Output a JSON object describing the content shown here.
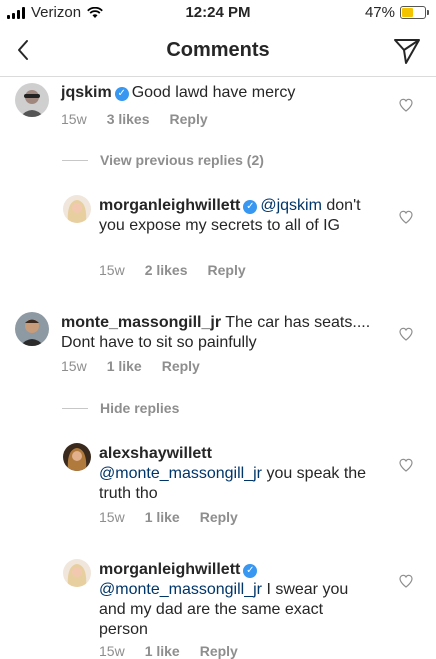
{
  "status_bar": {
    "carrier": "Verizon",
    "time": "12:24 PM",
    "battery_pct": "47%",
    "battery_level": 0.47
  },
  "nav": {
    "title": "Comments"
  },
  "comments": [
    {
      "username": "jqskim",
      "verified": true,
      "text": "Good lawd have mercy",
      "age": "15w",
      "likes": "3 likes",
      "reply": "Reply"
    },
    {
      "username": "morganleighwillett",
      "verified": true,
      "mention": "@jqskim",
      "text": "don't you expose my secrets to all of IG",
      "age": "15w",
      "likes": "2 likes",
      "reply": "Reply"
    },
    {
      "username": "monte_massongill_jr",
      "verified": false,
      "text": "The car has seats.... Dont have to sit so painfully",
      "age": "15w",
      "likes": "1 like",
      "reply": "Reply"
    },
    {
      "username": "alexshaywillett",
      "verified": false,
      "mention": "@monte_massongill_jr",
      "text": "you speak the truth tho",
      "age": "15w",
      "likes": "1 like",
      "reply": "Reply"
    },
    {
      "username": "morganleighwillett",
      "verified": true,
      "mention": "@monte_massongill_jr",
      "text": "I swear you and my dad are the same exact person",
      "age": "15w",
      "likes": "1 like",
      "reply": "Reply"
    }
  ],
  "threads": {
    "view_previous": "View previous replies (2)",
    "hide_replies": "Hide replies"
  },
  "colors": {
    "verified_blue": "#3897f0",
    "mention": "#003569",
    "meta_gray": "#8e8e8e",
    "battery_yellow": "#f5c400"
  }
}
